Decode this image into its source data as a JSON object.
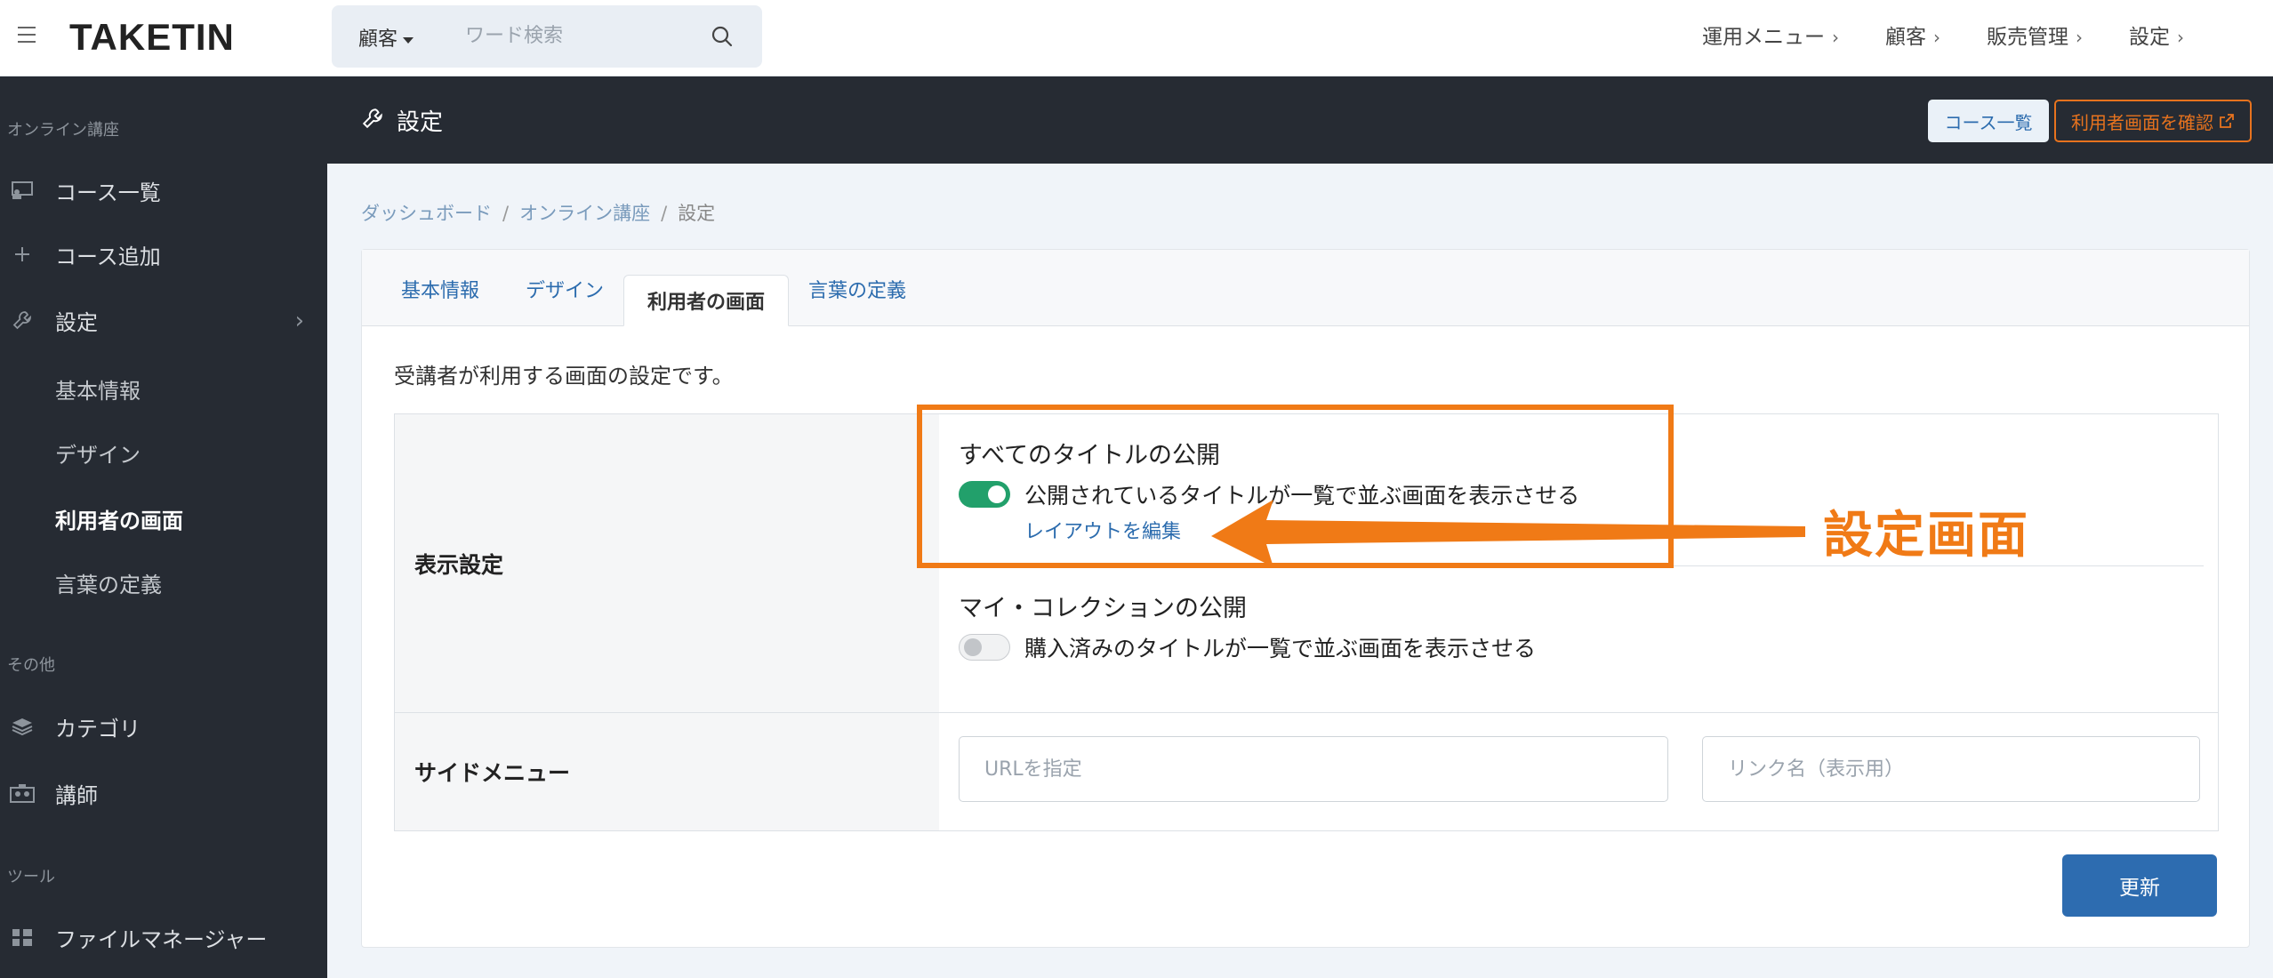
{
  "header": {
    "logo": "TAKETIN",
    "search": {
      "scope": "顧客",
      "placeholder": "ワード検索"
    },
    "nav": [
      "運用メニュー",
      "顧客",
      "販売管理",
      "設定"
    ],
    "chevron": "›"
  },
  "sidebar": {
    "section_online": "オンライン講座",
    "course_list": "コース一覧",
    "course_add": "コース追加",
    "settings": "設定",
    "sub": [
      "基本情報",
      "デザイン",
      "利用者の画面",
      "言葉の定義"
    ],
    "section_other": "その他",
    "category": "カテゴリ",
    "instructor": "講師",
    "section_tools": "ツール",
    "file_manager": "ファイルマネージャー"
  },
  "pagehead": {
    "title": "設定",
    "course_list_button": "コース一覧",
    "user_view_button": "利用者画面を確認"
  },
  "breadcrumb": [
    "ダッシュボード",
    "オンライン講座",
    "設定"
  ],
  "tabs": [
    "基本情報",
    "デザイン",
    "利用者の画面",
    "言葉の定義"
  ],
  "description": "受講者が利用する画面の設定です。",
  "display_settings": {
    "label": "表示設定",
    "all_titles": {
      "title": "すべてのタイトルの公開",
      "toggle_label": "公開されているタイトルが一覧で並ぶ画面を表示させる",
      "enabled": true,
      "edit_link": "レイアウトを編集"
    },
    "my_collection": {
      "title": "マイ・コレクションの公開",
      "toggle_label": "購入済みのタイトルが一覧で並ぶ画面を表示させる",
      "enabled": false
    }
  },
  "side_menu": {
    "label": "サイドメニュー",
    "url_placeholder": "URLを指定",
    "link_name_placeholder": "リンク名（表示用）"
  },
  "update_button": "更新",
  "annotation": {
    "text": "設定画面",
    "color": "#f07a16"
  },
  "colors": {
    "sidebar_bg": "#262b33",
    "accent_blue": "#2c6cae",
    "toggle_on": "#22a06b",
    "orange": "#e8731e"
  }
}
